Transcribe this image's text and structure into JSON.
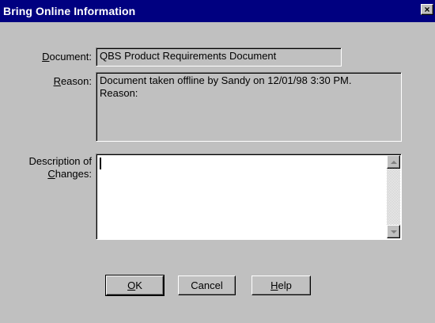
{
  "window": {
    "title": "Bring Online Information",
    "close_glyph": "×"
  },
  "document": {
    "label_mnemonic": "D",
    "label_rest": "ocument:",
    "value": "QBS Product Requirements Document"
  },
  "reason": {
    "label_mnemonic": "R",
    "label_rest": "eason:",
    "value_line1": "Document taken offline by Sandy on 12/01/98 3:30 PM.",
    "value_line2": "Reason:"
  },
  "description": {
    "label_line1": "Description of",
    "label_line2_mnemonic": "C",
    "label_line2_rest": "hanges:",
    "value": ""
  },
  "buttons": {
    "ok_mnemonic": "O",
    "ok_rest": "K",
    "cancel": "Cancel",
    "help_mnemonic": "H",
    "help_rest": "elp"
  }
}
